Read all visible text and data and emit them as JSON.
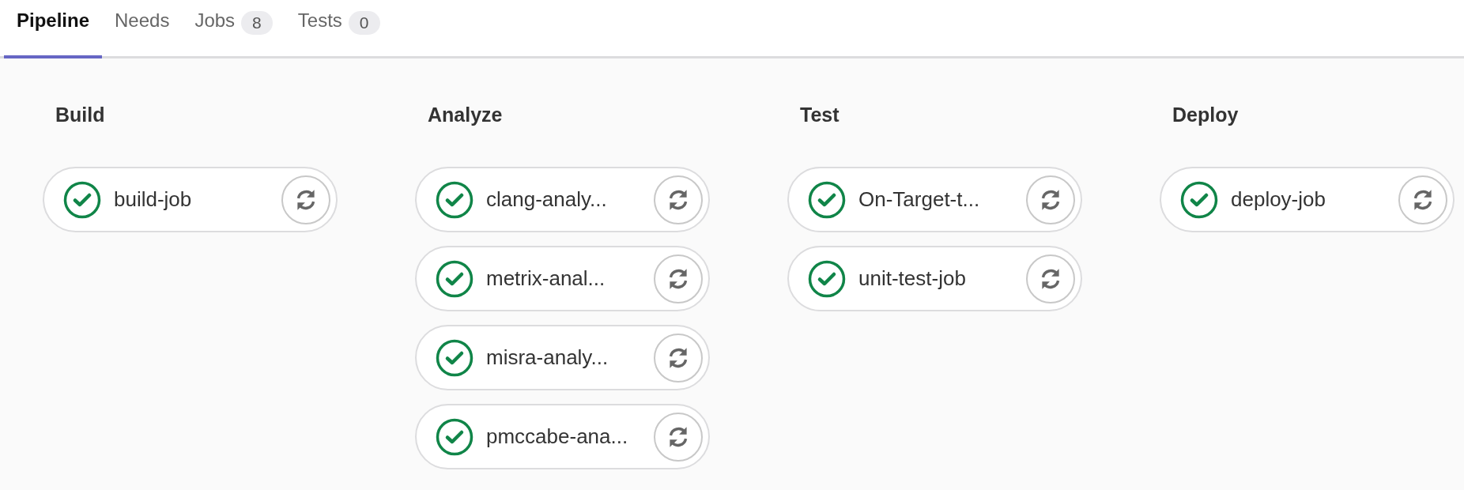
{
  "tabs": [
    {
      "label": "Pipeline",
      "selected": true
    },
    {
      "label": "Needs",
      "selected": false
    },
    {
      "label": "Jobs",
      "badge": "8",
      "selected": false
    },
    {
      "label": "Tests",
      "badge": "0",
      "selected": false
    }
  ],
  "stages": [
    {
      "title": "Build",
      "jobs": [
        {
          "name": "build-job",
          "passed": true
        }
      ]
    },
    {
      "title": "Analyze",
      "jobs": [
        {
          "name": "clang-analy...",
          "passed": true
        },
        {
          "name": "metrix-anal...",
          "passed": true
        },
        {
          "name": "misra-analy...",
          "passed": true
        },
        {
          "name": "pmccabe-ana...",
          "passed": true
        }
      ]
    },
    {
      "title": "Test",
      "jobs": [
        {
          "name": "On-Target-t...",
          "passed": true
        },
        {
          "name": "unit-test-job",
          "passed": true
        }
      ]
    },
    {
      "title": "Deploy",
      "jobs": [
        {
          "name": "deploy-job",
          "passed": true
        }
      ]
    }
  ]
}
